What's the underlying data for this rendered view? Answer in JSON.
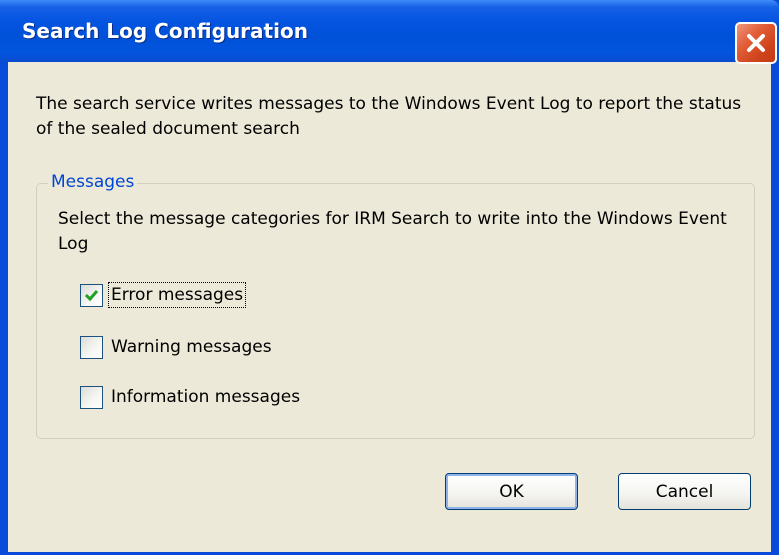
{
  "window": {
    "title": "Search Log Configuration"
  },
  "intro_text": "The search service writes messages to the Windows Event Log to report the status of the sealed document search",
  "messages_group": {
    "legend": "Messages",
    "description": "Select the message categories for IRM Search to write into the Windows Event Log",
    "checkboxes": [
      {
        "label": "Error messages",
        "checked": true
      },
      {
        "label": "Warning messages",
        "checked": false
      },
      {
        "label": "Information messages",
        "checked": false
      }
    ]
  },
  "buttons": {
    "ok_label": "OK",
    "cancel_label": "Cancel"
  },
  "icons": {
    "close": "close-icon",
    "checkmark": "checkmark-icon"
  },
  "colors": {
    "titlebar": "#0454e0",
    "close_button": "#d0441c",
    "legend_text": "#0046d5",
    "checkmark": "#21a121",
    "dialog_background": "#ece9d8"
  }
}
